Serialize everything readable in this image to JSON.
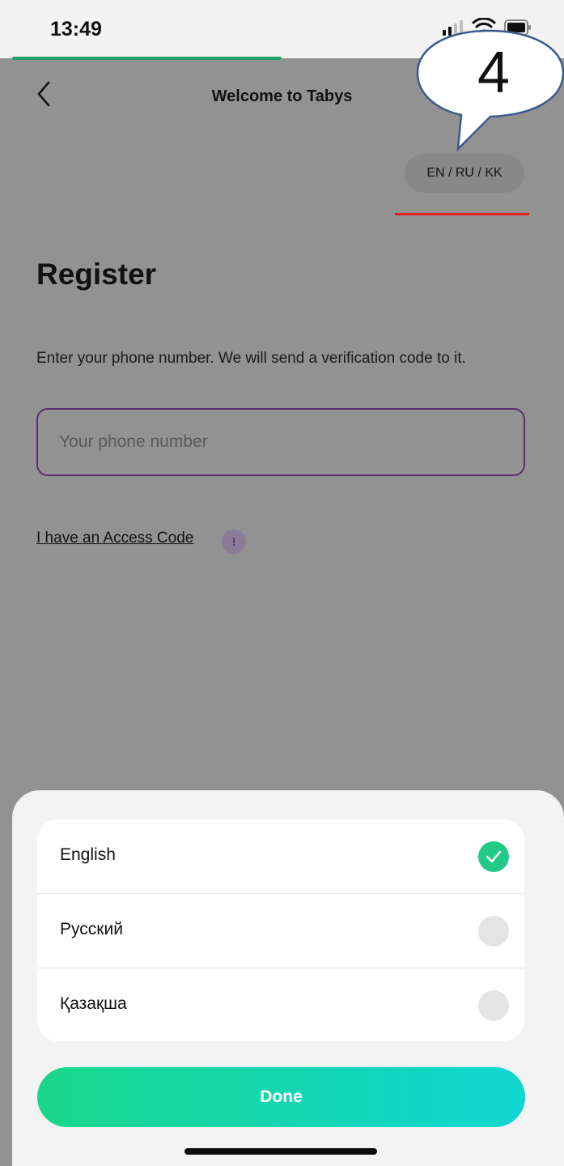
{
  "status_bar": {
    "time": "13:49"
  },
  "header": {
    "title": "Welcome to Tabys",
    "language_switch": "EN / RU / KK"
  },
  "annotation": {
    "callout_number": "4"
  },
  "main": {
    "heading": "Register",
    "description": "Enter your phone number. We will send a verification code to it.",
    "phone_placeholder": "Your phone number",
    "access_code_link": "I have an Access Code",
    "access_code_info": "!"
  },
  "language_sheet": {
    "options": [
      {
        "label": "English",
        "selected": true
      },
      {
        "label": "Русский",
        "selected": false
      },
      {
        "label": "Қазақша",
        "selected": false
      }
    ],
    "done_label": "Done"
  },
  "colors": {
    "accent_green": "#22c987",
    "progress_green": "#1fa06b",
    "input_border": "#5a2e72",
    "underline_red": "#e41e1e"
  }
}
